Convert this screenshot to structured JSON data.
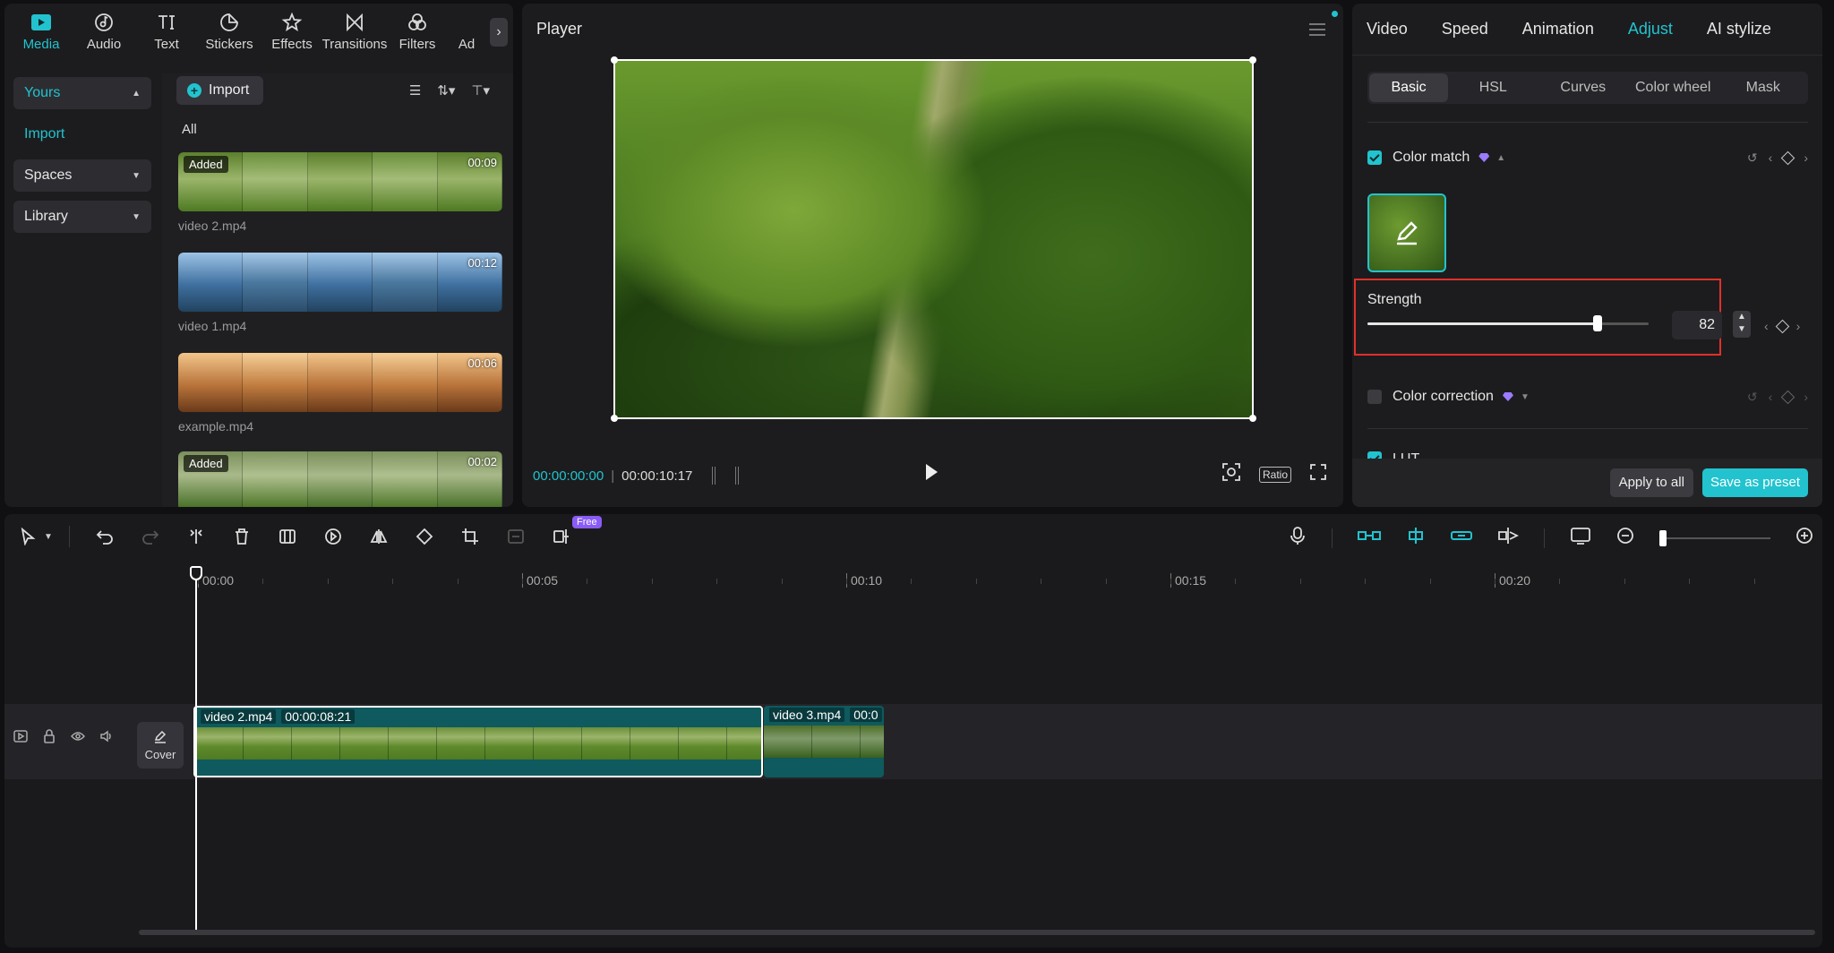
{
  "colors": {
    "accent": "#22c3cf",
    "highlight_border": "#e0302a",
    "panel": "#1c1c1e",
    "premium": "#9b7bff"
  },
  "media_toolbar": {
    "tabs": [
      {
        "label": "Media",
        "icon": "media-icon",
        "active": true
      },
      {
        "label": "Audio",
        "icon": "audio-icon"
      },
      {
        "label": "Text",
        "icon": "text-icon"
      },
      {
        "label": "Stickers",
        "icon": "stickers-icon"
      },
      {
        "label": "Effects",
        "icon": "effects-icon"
      },
      {
        "label": "Transitions",
        "icon": "transitions-icon"
      },
      {
        "label": "Filters",
        "icon": "filters-icon"
      },
      {
        "label": "Ad",
        "icon": "adjust-icon"
      }
    ],
    "more": "›"
  },
  "media_sidebar": {
    "yours": "Yours",
    "import_link": "Import",
    "spaces": "Spaces",
    "library": "Library"
  },
  "media_list": {
    "import_button": "Import",
    "all_label": "All",
    "clips": [
      {
        "name": "video 2.mp4",
        "badge": "Added",
        "duration": "00:09"
      },
      {
        "name": "video 1.mp4",
        "badge": "",
        "duration": "00:12"
      },
      {
        "name": "example.mp4",
        "badge": "",
        "duration": "00:06"
      },
      {
        "name": "",
        "badge": "Added",
        "duration": "00:02"
      }
    ]
  },
  "player": {
    "title": "Player",
    "current_time": "00:00:00:00",
    "total_time": "00:00:10:17",
    "ratio_label": "Ratio"
  },
  "adjust": {
    "tabs": [
      "Video",
      "Speed",
      "Animation",
      "Adjust",
      "AI stylize"
    ],
    "active_tab": "Adjust",
    "sub_tabs": [
      "Basic",
      "HSL",
      "Curves",
      "Color wheel",
      "Mask"
    ],
    "active_sub_tab": "Basic",
    "color_match": {
      "label": "Color match",
      "checked": true
    },
    "strength": {
      "label": "Strength",
      "value": "82",
      "level": 0.82
    },
    "color_correction": {
      "label": "Color correction",
      "checked": false
    },
    "lut_partial": "LUT",
    "apply_all": "Apply to all",
    "save_preset": "Save as preset"
  },
  "timeline": {
    "free_badge": "Free",
    "ruler_marks": [
      "00:00",
      "00:05",
      "00:10",
      "00:15",
      "00:20"
    ],
    "cover_label": "Cover",
    "clips": [
      {
        "name": "video 2.mp4",
        "duration": "00:00:08:21"
      },
      {
        "name": "video 3.mp4",
        "duration": "00:0"
      }
    ]
  }
}
